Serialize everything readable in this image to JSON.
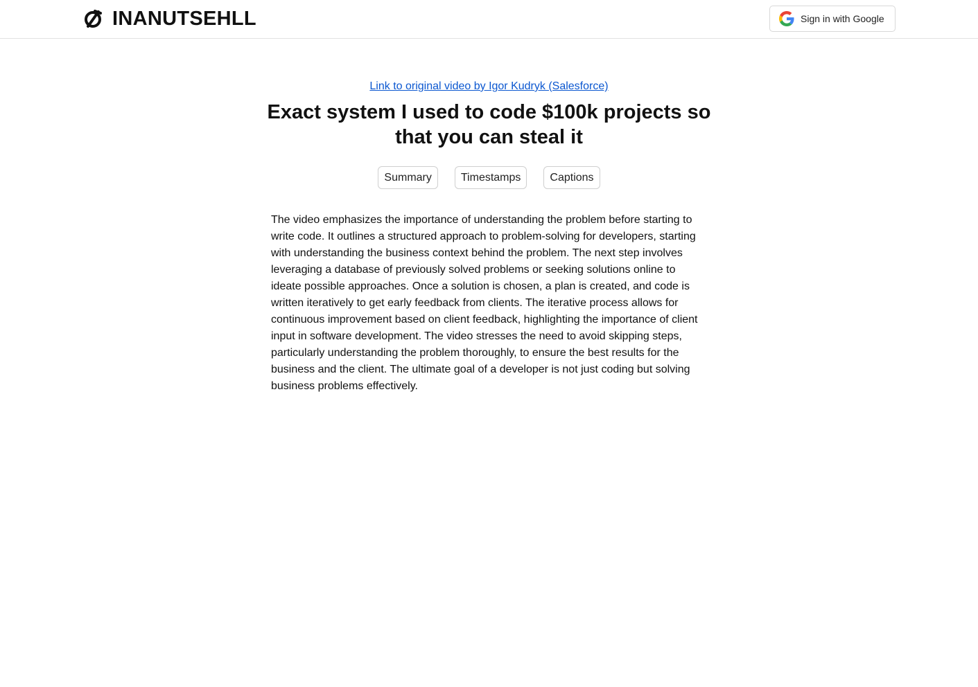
{
  "brand": {
    "name": "INANUTSEHLL",
    "logo_icon": "nut-logo-icon"
  },
  "auth": {
    "signin_label": "Sign in with Google",
    "icon": "google-g-icon"
  },
  "video": {
    "source_link_text": "Link to original video by Igor Kudryk (Salesforce)",
    "title": "Exact system I used to code $100k projects so that you can steal it"
  },
  "tabs": [
    {
      "label": "Summary"
    },
    {
      "label": "Timestamps"
    },
    {
      "label": "Captions"
    }
  ],
  "summary": {
    "text": "The video emphasizes the importance of understanding the problem before starting to write code. It outlines a structured approach to problem-solving for developers, starting with understanding the business context behind the problem. The next step involves leveraging a database of previously solved problems or seeking solutions online to ideate possible approaches. Once a solution is chosen, a plan is created, and code is written iteratively to get early feedback from clients. The iterative process allows for continuous improvement based on client feedback, highlighting the importance of client input in software development. The video stresses the need to avoid skipping steps, particularly understanding the problem thoroughly, to ensure the best results for the business and the client. The ultimate goal of a developer is not just coding but solving business problems effectively."
  },
  "colors": {
    "link": "#0b57d0",
    "text": "#111111",
    "border": "#cfcfcf",
    "google_blue": "#4285F4",
    "google_red": "#EA4335",
    "google_yellow": "#FBBC05",
    "google_green": "#34A853"
  }
}
